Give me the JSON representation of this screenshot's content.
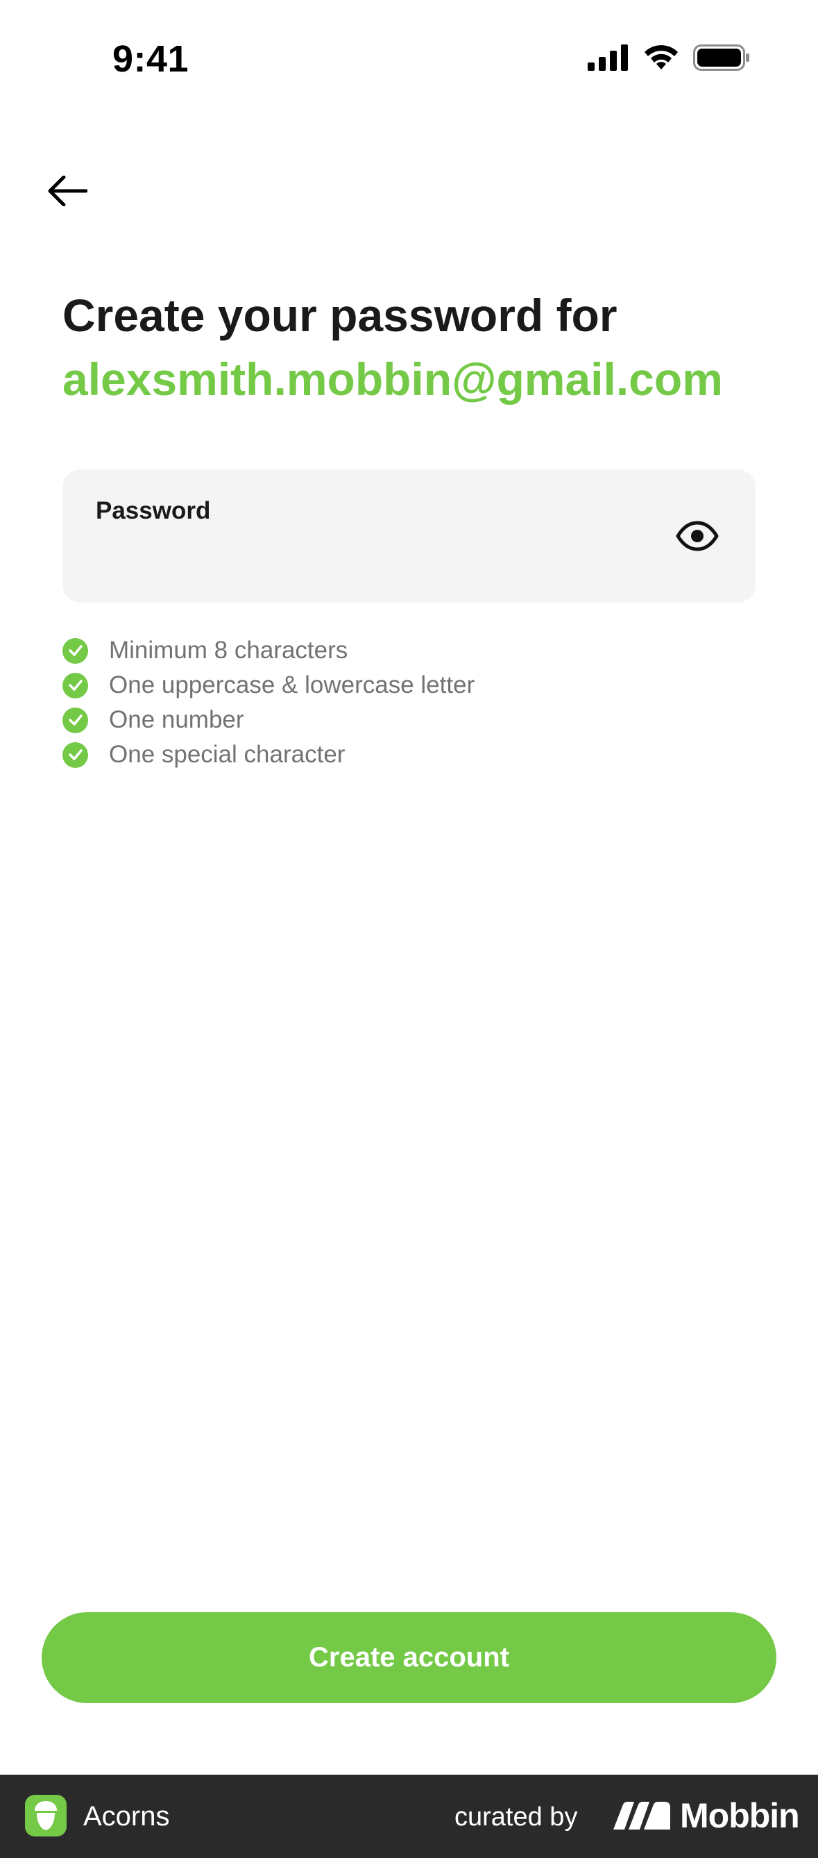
{
  "status_bar": {
    "time": "9:41",
    "icons": [
      "signal-icon",
      "wifi-icon",
      "battery-icon"
    ]
  },
  "navigation": {
    "back_icon": "arrow-left-icon"
  },
  "header": {
    "title": "Create your password for",
    "email": "alexsmith.mobbin@gmail.com"
  },
  "password_field": {
    "label": "Password",
    "value": "",
    "toggle_icon": "eye-icon"
  },
  "requirements": [
    {
      "text": "Minimum 8 characters",
      "met": true
    },
    {
      "text": "One uppercase & lowercase letter",
      "met": true
    },
    {
      "text": "One number",
      "met": true
    },
    {
      "text": "One special character",
      "met": true
    }
  ],
  "actions": {
    "create_account_label": "Create account"
  },
  "footer": {
    "app_name": "Acorns",
    "curated_by": "curated by",
    "brand": "Mobbin"
  },
  "colors": {
    "accent": "#74c947",
    "text": "#1a1a1a",
    "muted": "#727272",
    "field_bg": "#f4f4f4",
    "footer_bg": "#2a2a2b"
  }
}
